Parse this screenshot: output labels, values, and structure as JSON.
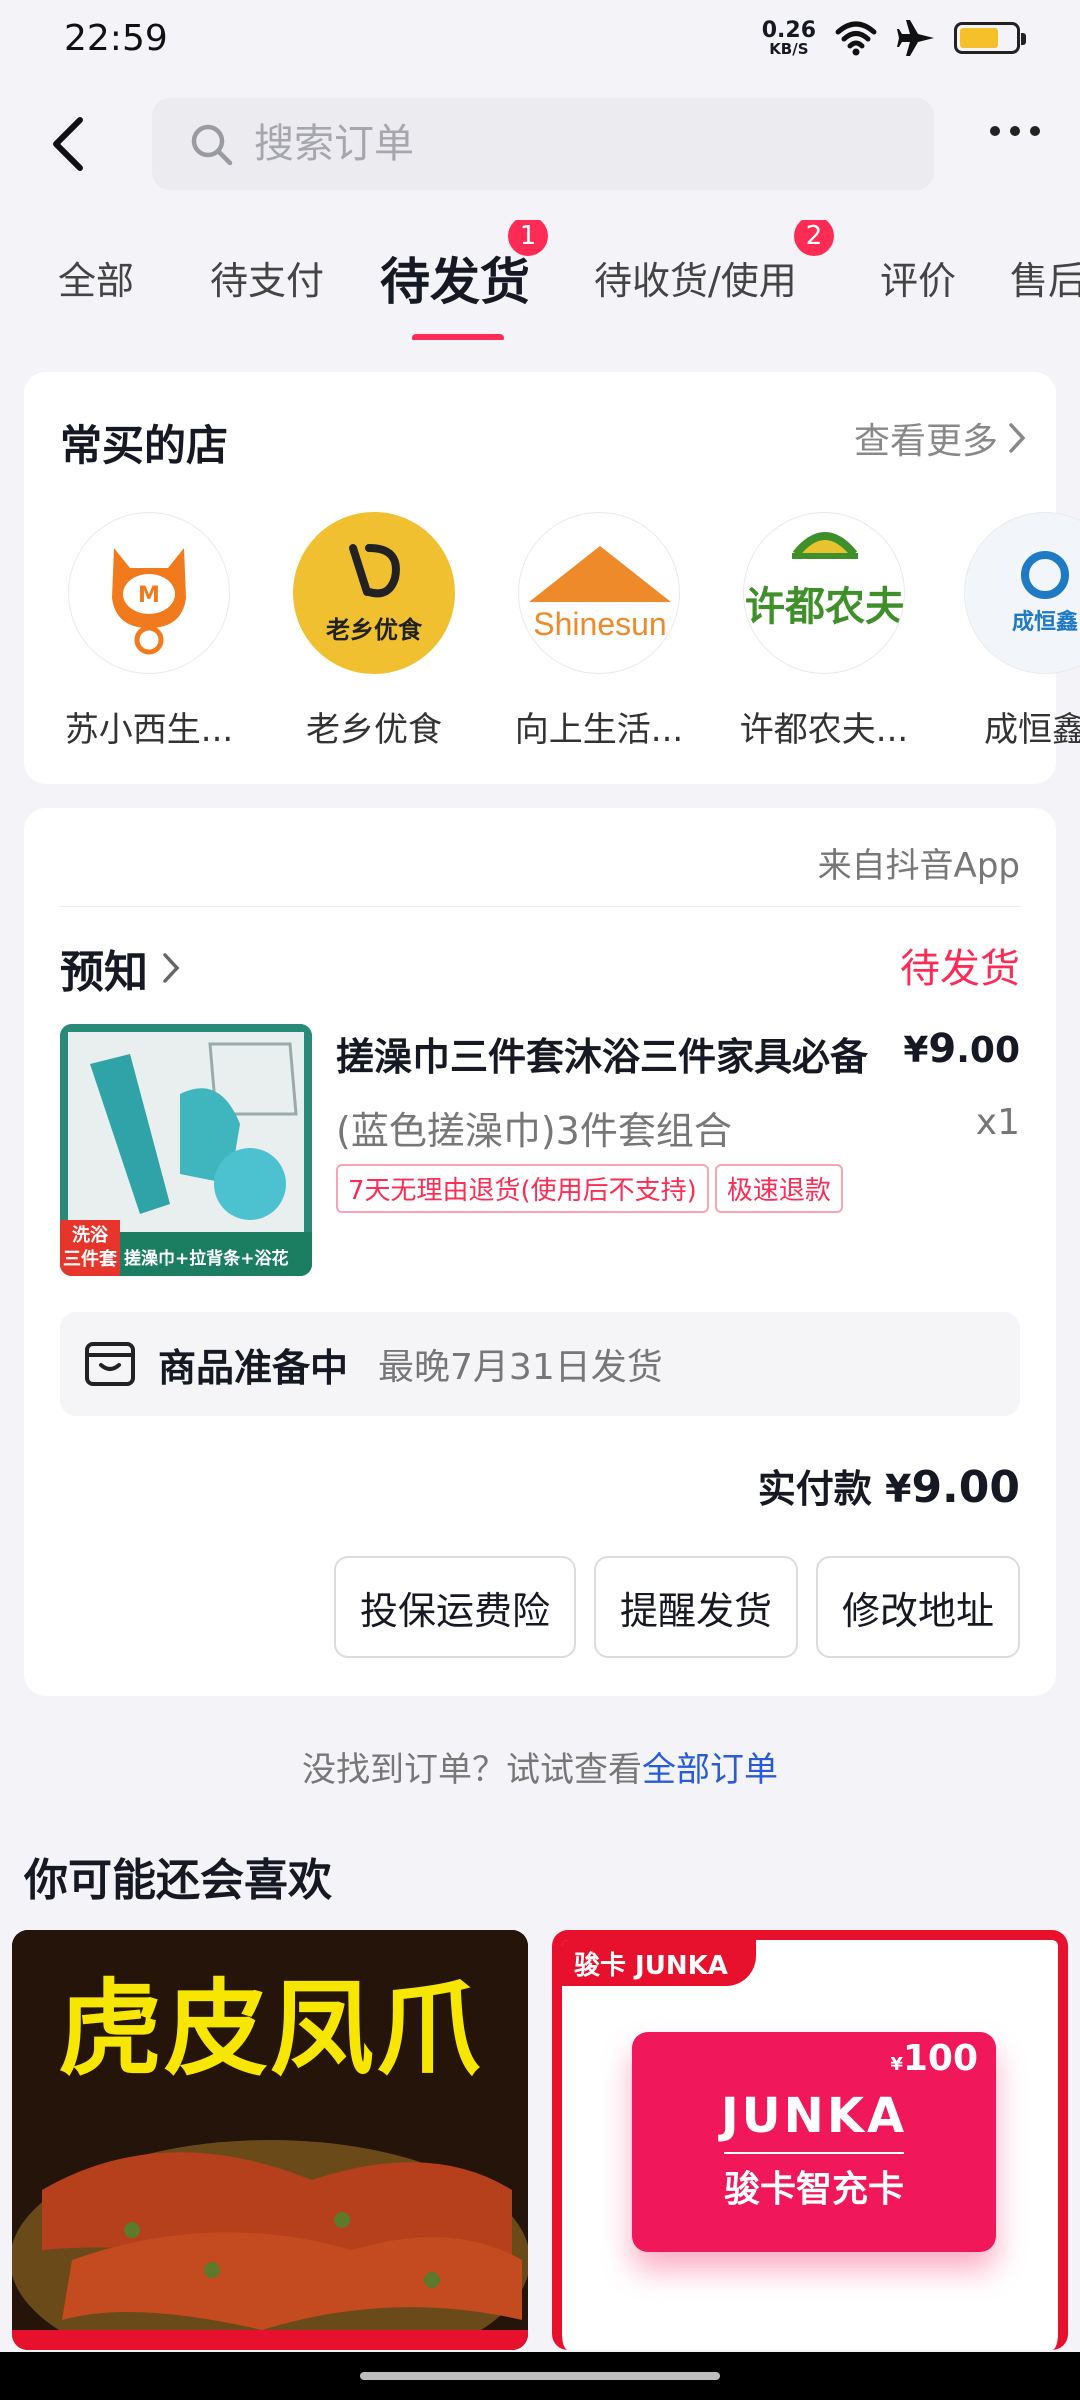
{
  "status_bar": {
    "time": "22:59",
    "net_speed_value": "0.26",
    "net_speed_unit": "KB/S",
    "battery_color": "#f5c02a"
  },
  "header": {
    "search_placeholder": "搜索订单"
  },
  "tabs": [
    {
      "label": "全部"
    },
    {
      "label": "待支付"
    },
    {
      "label": "待发货",
      "badge": "1",
      "active": true
    },
    {
      "label": "待收货/使用",
      "badge": "2"
    },
    {
      "label": "评价"
    },
    {
      "label": "售后"
    }
  ],
  "stores": {
    "title": "常买的店",
    "see_more": "查看更多",
    "items": [
      {
        "name": "苏小西生..."
      },
      {
        "name": "老乡优食",
        "logo_text": "老乡优食"
      },
      {
        "name": "向上生活...",
        "logo_text": "Shinesun"
      },
      {
        "name": "许都农夫...",
        "logo_text": "许都农夫"
      },
      {
        "name": "成恒鑫",
        "logo_text": "成恒鑫"
      }
    ]
  },
  "order": {
    "source": "来自抖音App",
    "shop_name": "预知",
    "status": "待发货",
    "product": {
      "title": "搓澡巾三件套沐浴三件家具必备",
      "price_symbol": "¥",
      "price_int": "9",
      "price_dec": ".00",
      "spec": "(蓝色搓澡巾)3件套组合",
      "qty": "x1",
      "image_badge": "洗浴\n三件套",
      "image_caption": "搓澡巾+拉背条+浴花",
      "tags": [
        "7天无理由退货(使用后不支持)",
        "极速退款"
      ]
    },
    "shipping": {
      "status": "商品准备中",
      "note": "最晚7月31日发货"
    },
    "paid_label": "实付款",
    "paid_symbol": "¥",
    "paid_amount": "9.00",
    "actions": [
      "投保运费险",
      "提醒发货",
      "修改地址"
    ]
  },
  "hint": {
    "text": "没找到订单？试试查看",
    "link": "全部订单"
  },
  "recommend": {
    "title": "你可能还会喜欢",
    "item1_text": "虎皮凤爪",
    "item2_brand": "骏卡 JUNKA",
    "item2_card_title": "JUNKA",
    "item2_card_sub": "骏卡智充卡",
    "item2_value": "100",
    "item2_value_symbol": "¥"
  }
}
